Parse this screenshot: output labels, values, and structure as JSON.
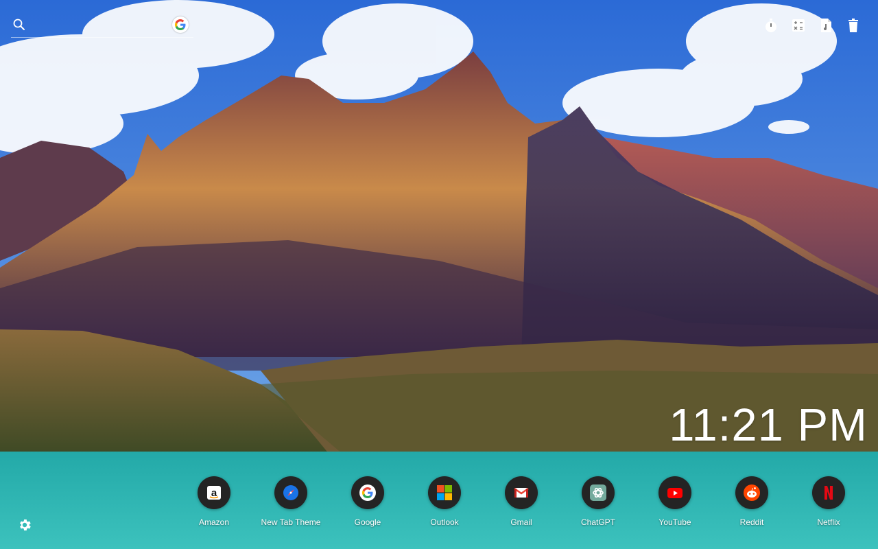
{
  "background": {
    "sky_top": "#2f6fd6",
    "sky_bottom": "#6ea6e6",
    "lake": "#2cb8b3"
  },
  "search": {
    "placeholder": "",
    "icon": "search-icon",
    "engine_icon": "google-icon"
  },
  "toolbar": [
    {
      "name": "timer",
      "icon": "stopwatch-icon"
    },
    {
      "name": "calculator",
      "icon": "calculator-icon"
    },
    {
      "name": "documents",
      "icon": "file-icon"
    },
    {
      "name": "trash",
      "icon": "trash-icon"
    }
  ],
  "clock": {
    "time": "11:21 PM"
  },
  "shortcuts": [
    {
      "label": "Amazon",
      "icon": "amazon-icon"
    },
    {
      "label": "New Tab Theme",
      "icon": "compass-icon"
    },
    {
      "label": "Google",
      "icon": "google-icon"
    },
    {
      "label": "Outlook",
      "icon": "microsoft-icon"
    },
    {
      "label": "Gmail",
      "icon": "gmail-icon"
    },
    {
      "label": "ChatGPT",
      "icon": "chatgpt-icon"
    },
    {
      "label": "YouTube",
      "icon": "youtube-icon"
    },
    {
      "label": "Reddit",
      "icon": "reddit-icon"
    },
    {
      "label": "Netflix",
      "icon": "netflix-icon"
    }
  ],
  "settings": {
    "icon": "gear-icon"
  }
}
